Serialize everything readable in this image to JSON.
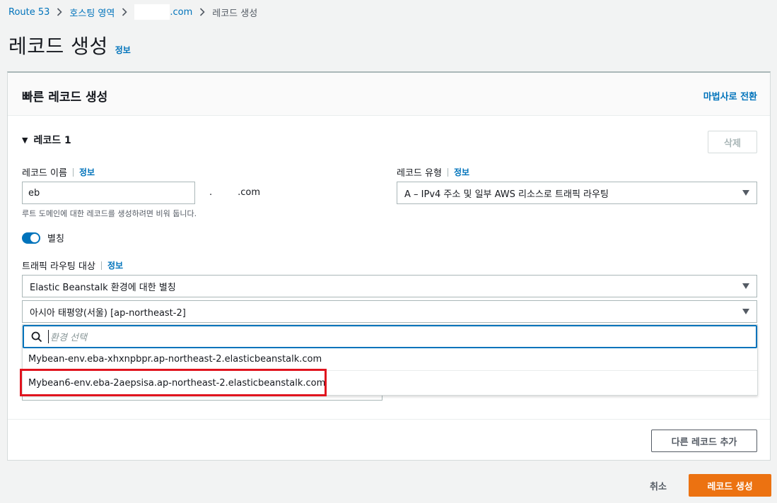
{
  "breadcrumb": {
    "route53": "Route 53",
    "hosted_zones": "호스팅 영역",
    "domain": ".com",
    "current": "레코드 생성"
  },
  "page": {
    "title": "레코드 생성",
    "info": "정보"
  },
  "panel": {
    "title": "빠른 레코드 생성",
    "wizard_link": "마법사로 전환"
  },
  "record": {
    "section_title": "레코드 1",
    "delete_label": "삭제",
    "name_label": "레코드 이름",
    "name_info": "정보",
    "name_value": "eb",
    "suffix_dot": ".",
    "suffix_tld": ".com",
    "name_hint": "루트 도메인에 대한 레코드를 생성하려면 비워 둡니다.",
    "type_label": "레코드 유형",
    "type_info": "정보",
    "type_value": "A – IPv4 주소 및 일부 AWS 리소스로 트래픽 라우팅",
    "alias_label": "별칭",
    "routing_label": "트래픽 라우팅 대상",
    "routing_info": "정보",
    "routing_target": "Elastic Beanstalk 환경에 대한 별칭",
    "region": "아시아 태평양(서울) [ap-northeast-2]",
    "env_placeholder": "환경 선택",
    "env_options": [
      "Mybean-env.eba-xhxnpbpr.ap-northeast-2.elasticbeanstalk.com",
      "Mybean6-env.eba-2aepsisa.ap-northeast-2.elasticbeanstalk.com"
    ]
  },
  "actions": {
    "add_record": "다른 레코드 추가",
    "cancel": "취소",
    "create": "레코드 생성"
  },
  "colors": {
    "link": "#0073bb",
    "primary_button": "#ec7211",
    "highlight": "#e0141e"
  }
}
